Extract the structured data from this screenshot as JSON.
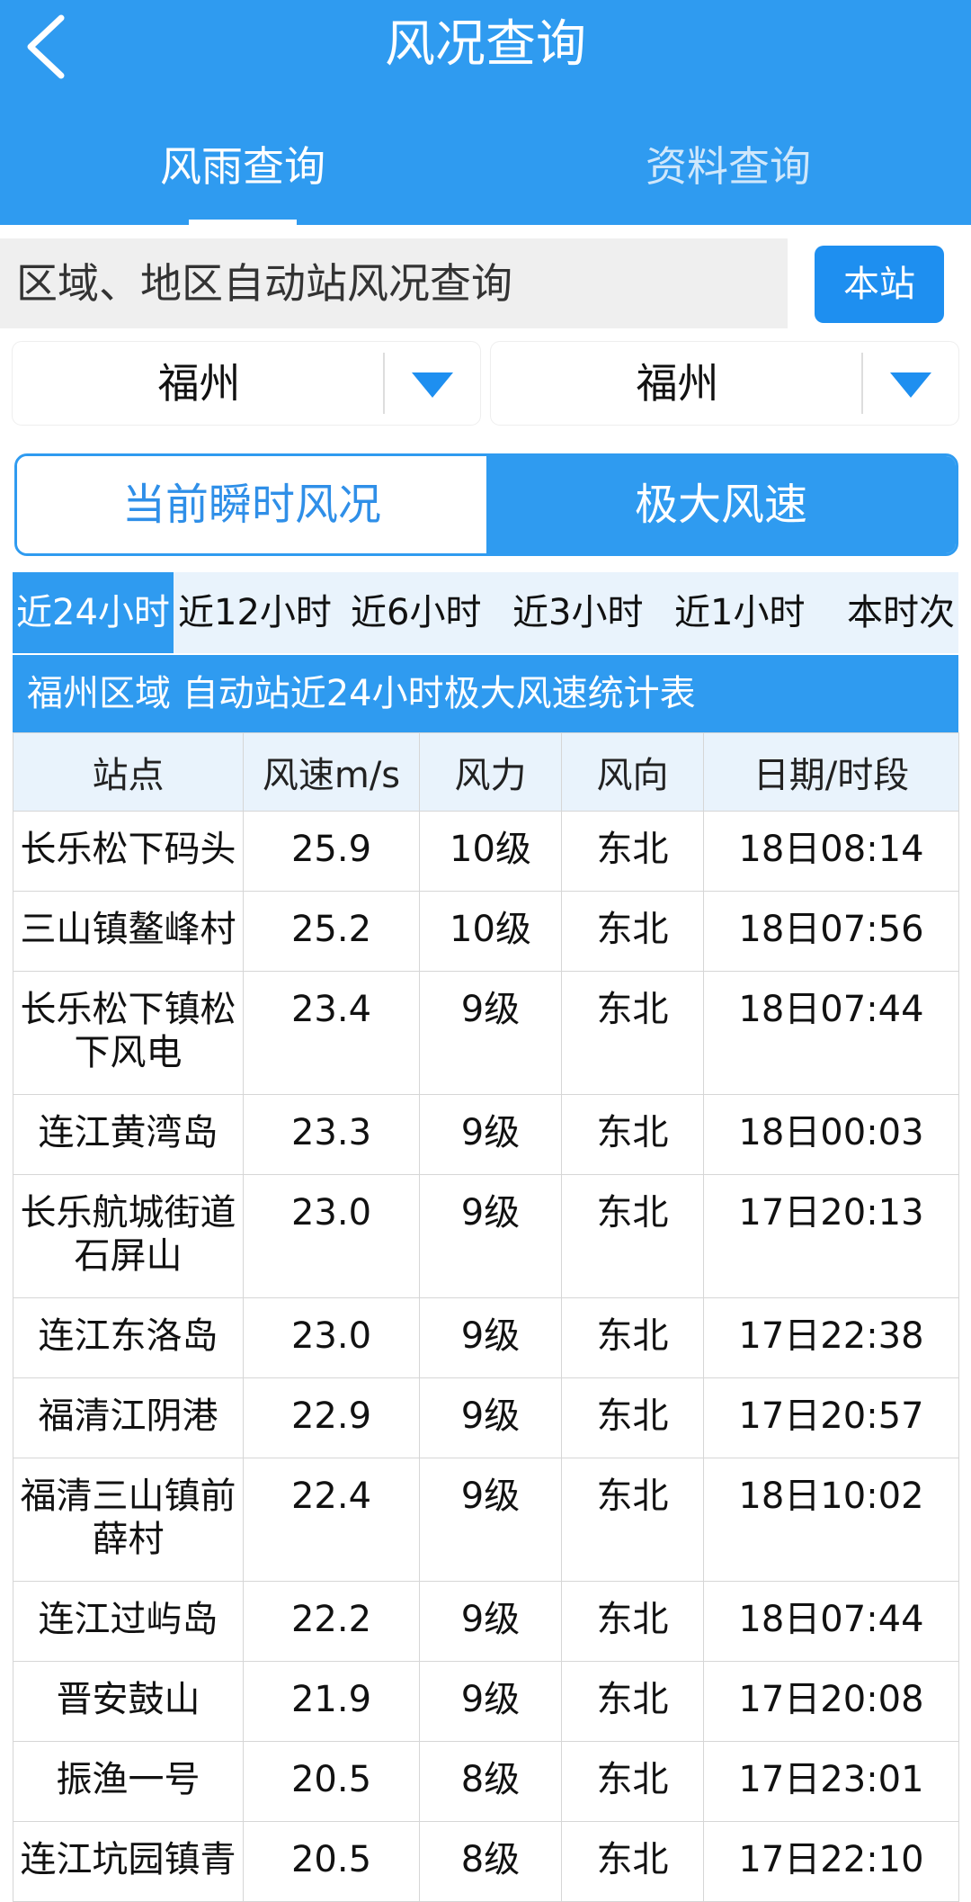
{
  "header": {
    "title": "风况查询"
  },
  "main_tabs": [
    {
      "label": "风雨查询",
      "active": true
    },
    {
      "label": "资料查询",
      "active": false
    }
  ],
  "query": {
    "label": "区域、地区自动站风况查询",
    "station_button": "本站"
  },
  "selects": [
    {
      "value": "福州"
    },
    {
      "value": "福州"
    }
  ],
  "mode_tabs": [
    {
      "label": "当前瞬时风况",
      "active": false
    },
    {
      "label": "极大风速",
      "active": true
    }
  ],
  "periods": [
    "近24小时",
    "近12小时",
    "近6小时",
    "近3小时",
    "近1小时",
    "本时次"
  ],
  "table": {
    "title": "福州区域 自动站近24小时极大风速统计表",
    "headers": [
      "站点",
      "风速m/s",
      "风力",
      "风向",
      "日期/时段"
    ],
    "rows": [
      [
        "长乐松下码头",
        "25.9",
        "10级",
        "东北",
        "18日08:14"
      ],
      [
        "三山镇鳌峰村",
        "25.2",
        "10级",
        "东北",
        "18日07:56"
      ],
      [
        "长乐松下镇松下风电",
        "23.4",
        "9级",
        "东北",
        "18日07:44"
      ],
      [
        "连江黄湾岛",
        "23.3",
        "9级",
        "东北",
        "18日00:03"
      ],
      [
        "长乐航城街道石屏山",
        "23.0",
        "9级",
        "东北",
        "17日20:13"
      ],
      [
        "连江东洛岛",
        "23.0",
        "9级",
        "东北",
        "17日22:38"
      ],
      [
        "福清江阴港",
        "22.9",
        "9级",
        "东北",
        "17日20:57"
      ],
      [
        "福清三山镇前薛村",
        "22.4",
        "9级",
        "东北",
        "18日10:02"
      ],
      [
        "连江过屿岛",
        "22.2",
        "9级",
        "东北",
        "18日07:44"
      ],
      [
        "晋安鼓山",
        "21.9",
        "9级",
        "东北",
        "17日20:08"
      ],
      [
        "振渔一号",
        "20.5",
        "8级",
        "东北",
        "17日23:01"
      ],
      [
        "连江坑园镇青",
        "20.5",
        "8级",
        "东北",
        "17日22:10"
      ]
    ]
  },
  "colors": {
    "primary": "#2f9bf0",
    "button": "#1e8ff0",
    "header_bg": "#e9f3fc"
  },
  "icons": {
    "back": "back-arrow-icon",
    "dropdown": "triangle-down-icon"
  }
}
